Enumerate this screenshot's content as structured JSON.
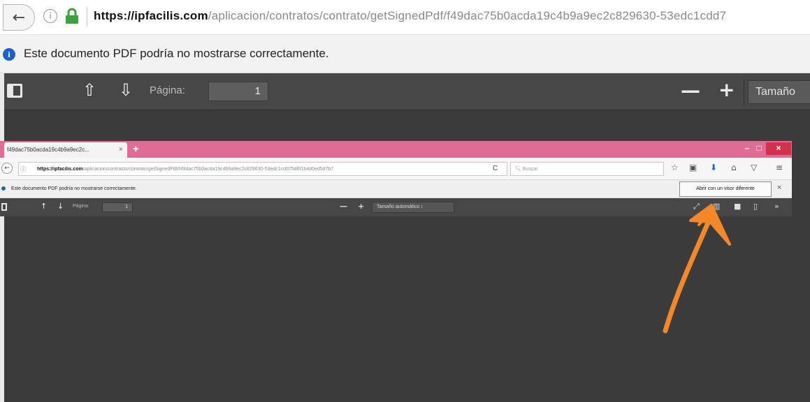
{
  "outer": {
    "url_host": "https://ipfacilis.com",
    "url_path": "/aplicacion/contratos/contrato/getSignedPdf/f49dac75b0acda19c4b9a9ec2c829630-53edc1cdd7",
    "notification_text": "Este documento PDF podría no mostrarse correctamente.",
    "toolbar": {
      "page_label": "Página:",
      "page_value": "1",
      "zoom_out": "—",
      "zoom_in": "+",
      "size_label": "Tamaño"
    }
  },
  "inner": {
    "tab_title": "f49dac75b0acda19c4b9a9ec2c...",
    "tab_close": "×",
    "new_tab": "+",
    "window_min": "–",
    "window_max": "□",
    "window_close": "×",
    "url_host": "https://ipfacilis.com",
    "url_path": "/aplicacion/contratos/contrato/getSignedPdf/f49dac75b0acda19c4b9a9ec2c829630-53edc1cdd75d6f1b4d0ed5d7b7",
    "reload": "C",
    "search_placeholder": "Buscar",
    "notification_text": "Este documento PDF podría no mostrarse correctamente.",
    "open_button": "Abrir con un visor diferente",
    "notification_close": "×",
    "toolbar": {
      "page_label": "Página:",
      "page_value": "1",
      "zoom_out": "—",
      "zoom_in": "+",
      "zoom_select": "Tamaño automático"
    }
  },
  "colors": {
    "viewer_bg": "#3b3b3b",
    "toolbar_bg": "#474747",
    "inner_tabbar": "#e06b96",
    "annotation_arrow": "#f5872b"
  }
}
